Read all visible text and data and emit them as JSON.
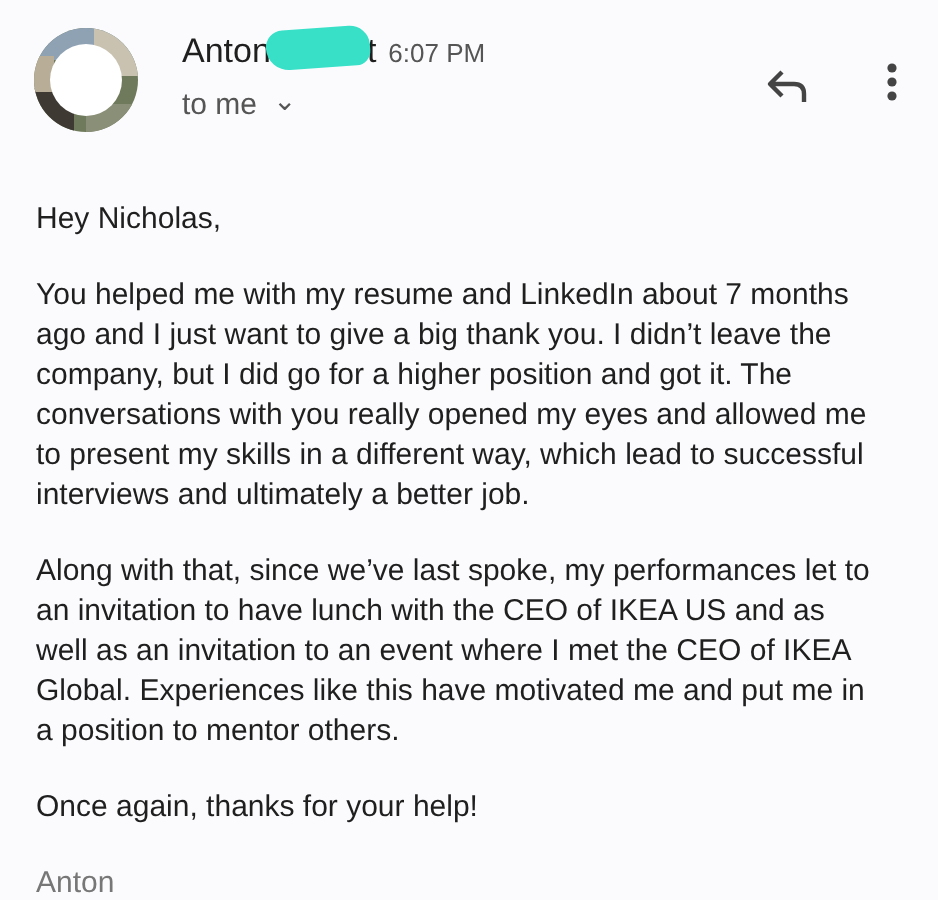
{
  "header": {
    "sender_parts": [
      "Anton",
      "t"
    ],
    "time": "6:07 PM",
    "recipient": "to me",
    "recipient_caret": "⌄"
  },
  "body": {
    "greeting": "Hey Nicholas,",
    "paragraphs": [
      "You helped me with my resume and LinkedIn about 7 months ago and I just want to give a big thank you. I didn’t leave the company, but I did go for a higher position and got it. The conversations with you really opened my eyes and allowed me to present my skills in a different way, which lead to successful interviews and ultimately a better job.",
      "Along with that, since we’ve last spoke, my performances let to an invitation to have lunch with the CEO of IKEA US and as well as an invitation to an event where I met the CEO of IKEA Global. Experiences like this have motivated me and put me in a position to mentor others.",
      "Once again, thanks for your help!"
    ],
    "signature": "Anton"
  }
}
